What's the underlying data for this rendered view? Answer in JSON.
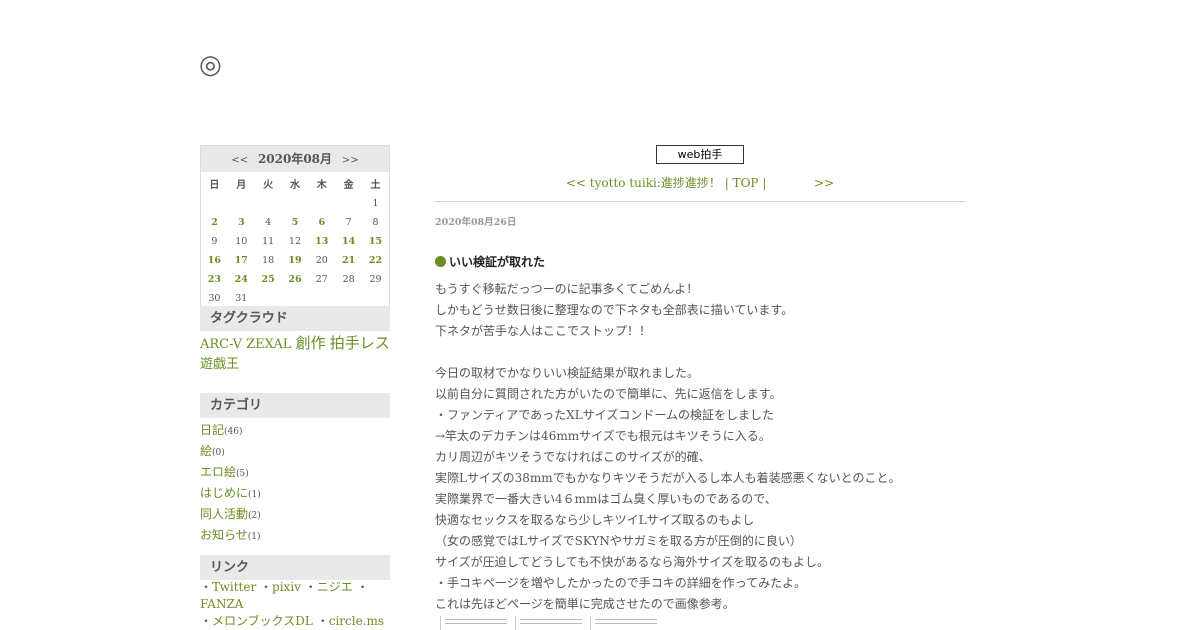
{
  "site": {
    "title_glyph": "◎"
  },
  "calendar": {
    "prev": "<<",
    "month": "2020年08月",
    "next": ">>",
    "weekdays": [
      "日",
      "月",
      "火",
      "水",
      "木",
      "金",
      "土"
    ],
    "weeks": [
      [
        {
          "d": ""
        },
        {
          "d": ""
        },
        {
          "d": ""
        },
        {
          "d": ""
        },
        {
          "d": ""
        },
        {
          "d": ""
        },
        {
          "d": "1"
        }
      ],
      [
        {
          "d": "2",
          "link": true
        },
        {
          "d": "3",
          "link": true
        },
        {
          "d": "4"
        },
        {
          "d": "5",
          "link": true
        },
        {
          "d": "6",
          "link": true
        },
        {
          "d": "7"
        },
        {
          "d": "8"
        }
      ],
      [
        {
          "d": "9"
        },
        {
          "d": "10"
        },
        {
          "d": "11"
        },
        {
          "d": "12"
        },
        {
          "d": "13",
          "link": true
        },
        {
          "d": "14",
          "link": true
        },
        {
          "d": "15",
          "link": true
        }
      ],
      [
        {
          "d": "16",
          "link": true
        },
        {
          "d": "17",
          "link": true
        },
        {
          "d": "18"
        },
        {
          "d": "19",
          "link": true
        },
        {
          "d": "20"
        },
        {
          "d": "21",
          "link": true
        },
        {
          "d": "22",
          "link": true
        }
      ],
      [
        {
          "d": "23",
          "link": true
        },
        {
          "d": "24",
          "link": true
        },
        {
          "d": "25",
          "link": true
        },
        {
          "d": "26",
          "link": true
        },
        {
          "d": "27"
        },
        {
          "d": "28"
        },
        {
          "d": "29"
        }
      ],
      [
        {
          "d": "30"
        },
        {
          "d": "31"
        },
        {
          "d": ""
        },
        {
          "d": ""
        },
        {
          "d": ""
        },
        {
          "d": ""
        },
        {
          "d": ""
        }
      ]
    ]
  },
  "sidebar": {
    "tag_heading": "タグクラウド",
    "tags": [
      {
        "label": "ARC-V",
        "big": false
      },
      {
        "label": "ZEXAL",
        "big": false
      },
      {
        "label": "創作",
        "big": true
      },
      {
        "label": "拍手レス",
        "big": true
      },
      {
        "label": "遊戯王",
        "big": false
      }
    ],
    "category_heading": "カテゴリ",
    "categories": [
      {
        "label": "日記",
        "count": "(46)"
      },
      {
        "label": "絵",
        "count": "(0)"
      },
      {
        "label": "エロ絵",
        "count": "(5)"
      },
      {
        "label": "はじめに",
        "count": "(1)"
      },
      {
        "label": "同人活動",
        "count": "(2)"
      },
      {
        "label": "お知らせ",
        "count": "(1)"
      }
    ],
    "link_heading": "リンク",
    "links": [
      [
        {
          "label": "Twitter"
        },
        {
          "label": "pixiv"
        },
        {
          "label": "ニジエ"
        },
        {
          "label": "FANZA"
        }
      ],
      [
        {
          "label": "メロンブックスDL"
        },
        {
          "label": "circle.ms"
        }
      ]
    ]
  },
  "main": {
    "clap_label": "web拍手",
    "pager": {
      "prev": "<< tyotto tuiki:進捗進捗！",
      "sep1": "|",
      "top": "TOP",
      "sep2": "|",
      "next": ">>"
    },
    "entry": {
      "date": "2020年08月26日",
      "title": "いい検証が取れた",
      "body": [
        "もうすぐ移転だっつーのに記事多くてごめんよ！",
        "しかもどうせ数日後に整理なので下ネタも全部表に描いています。",
        "下ネタが苦手な人はここでストップ！！",
        "",
        "今日の取材でかなりいい検証結果が取れました。",
        "以前自分に質問された方がいたので簡単に、先に返信をします。",
        "・ファンティアであったXLサイズコンドームの検証をしました",
        "→竿太のデカチンは46mmサイズでも根元はキツそうに入る。",
        "カリ周辺がキツそうでなければこのサイズが的確、",
        "実際Lサイズの38mmでもかなりキツそうだが入るし本人も着装感悪くないとのこと。",
        "実際業界で一番大きい4６mmはゴム臭く厚いものであるので、",
        "快適なセックスを取るなら少しキツイLサイズ取るのもよし",
        "（女の感覚ではLサイズでSKYNやサガミを取る方が圧倒的に良い）",
        "サイズが圧迫してどうしても不快があるなら海外サイズを取るのもよし。",
        "・手コキページを増やしたかったので手コキの詳細を作ってみたよ。",
        "これは先ほどページを簡単に完成させたので画像参考。"
      ]
    }
  }
}
